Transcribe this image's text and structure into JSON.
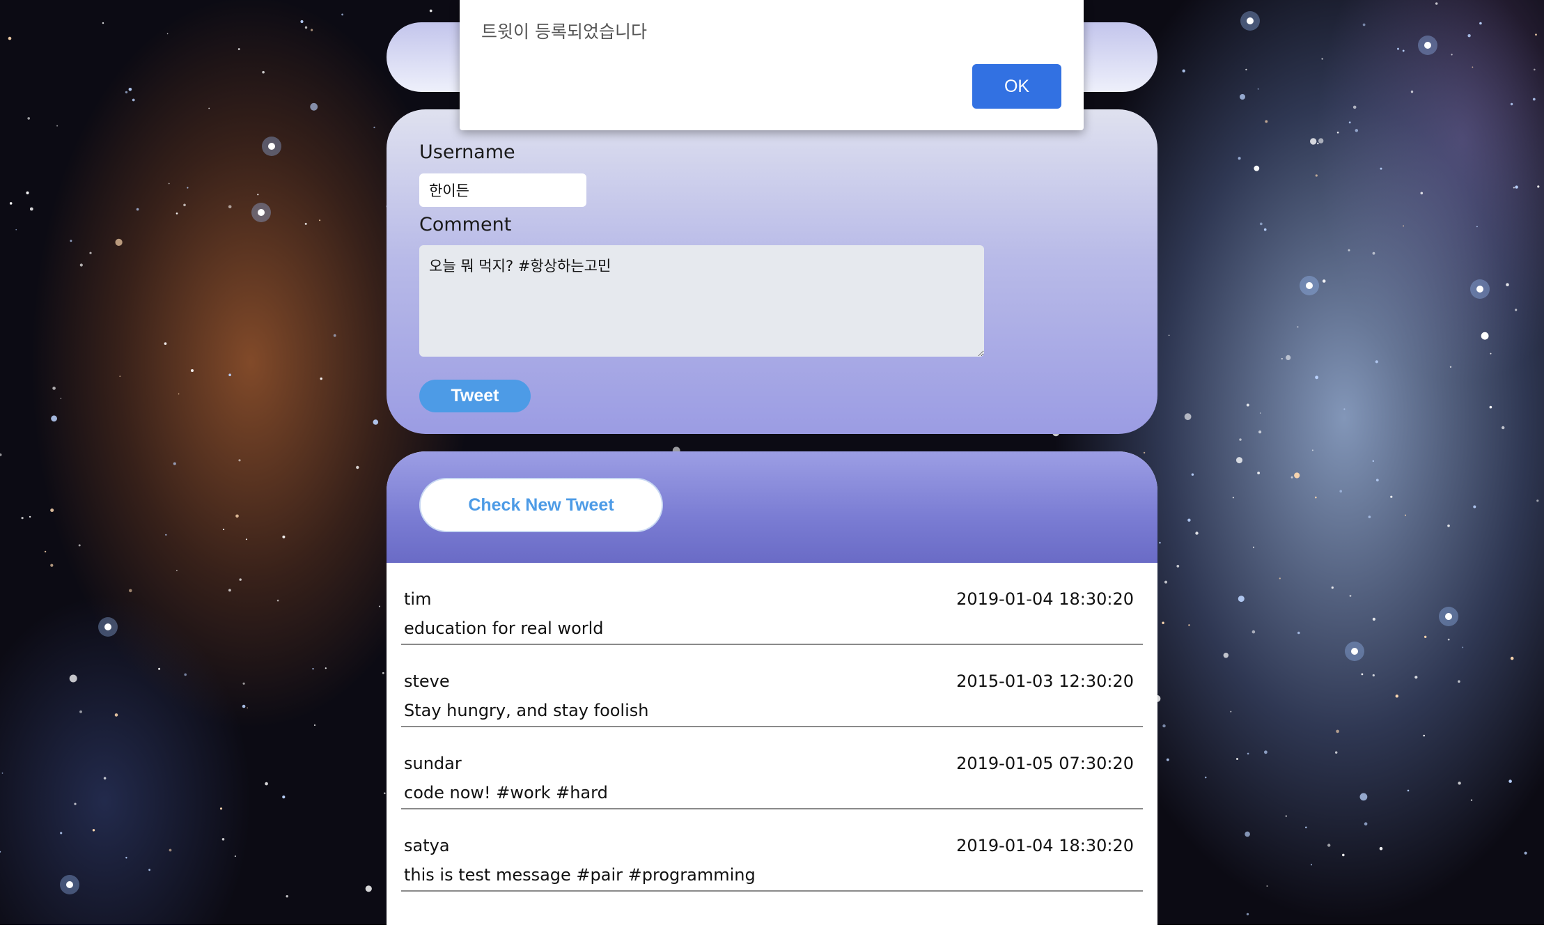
{
  "alert": {
    "message": "트윗이 등록되었습니다",
    "ok_label": "OK"
  },
  "form": {
    "username_label": "Username",
    "username_value": "한이든",
    "comment_label": "Comment",
    "comment_value": "오늘 뭐 먹지? #항상하는고민",
    "tweet_button": "Tweet"
  },
  "feed": {
    "check_button": "Check New Tweet",
    "tweets": [
      {
        "user": "tim",
        "time": "2019-01-04 18:30:20",
        "message": "education for real world"
      },
      {
        "user": "steve",
        "time": "2015-01-03 12:30:20",
        "message": "Stay hungry, and stay foolish"
      },
      {
        "user": "sundar",
        "time": "2019-01-05 07:30:20",
        "message": "code now! #work #hard"
      },
      {
        "user": "satya",
        "time": "2019-01-04 18:30:20",
        "message": "this is test message #pair #programming"
      }
    ]
  }
}
